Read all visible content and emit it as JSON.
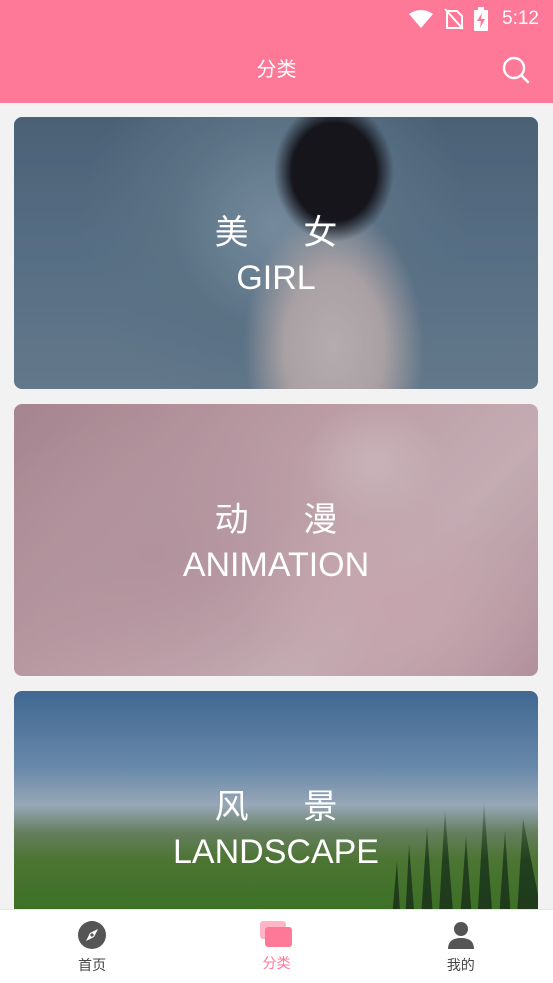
{
  "status_bar": {
    "time": "5:12",
    "icons": [
      "wifi-icon",
      "no-sim-icon",
      "battery-charging-icon"
    ]
  },
  "header": {
    "title": "分类",
    "search_icon": "search-icon"
  },
  "categories": [
    {
      "zh": "美 女",
      "en": "GIRL"
    },
    {
      "zh": "动 漫",
      "en": "ANIMATION"
    },
    {
      "zh": "风 景",
      "en": "LANDSCAPE"
    }
  ],
  "bottom_nav": {
    "items": [
      {
        "label": "首页",
        "icon": "compass-icon",
        "active": false
      },
      {
        "label": "分类",
        "icon": "category-icon",
        "active": true
      },
      {
        "label": "我的",
        "icon": "user-icon",
        "active": false
      }
    ]
  },
  "colors": {
    "accent": "#fe7898",
    "nav_inactive": "#555555"
  }
}
